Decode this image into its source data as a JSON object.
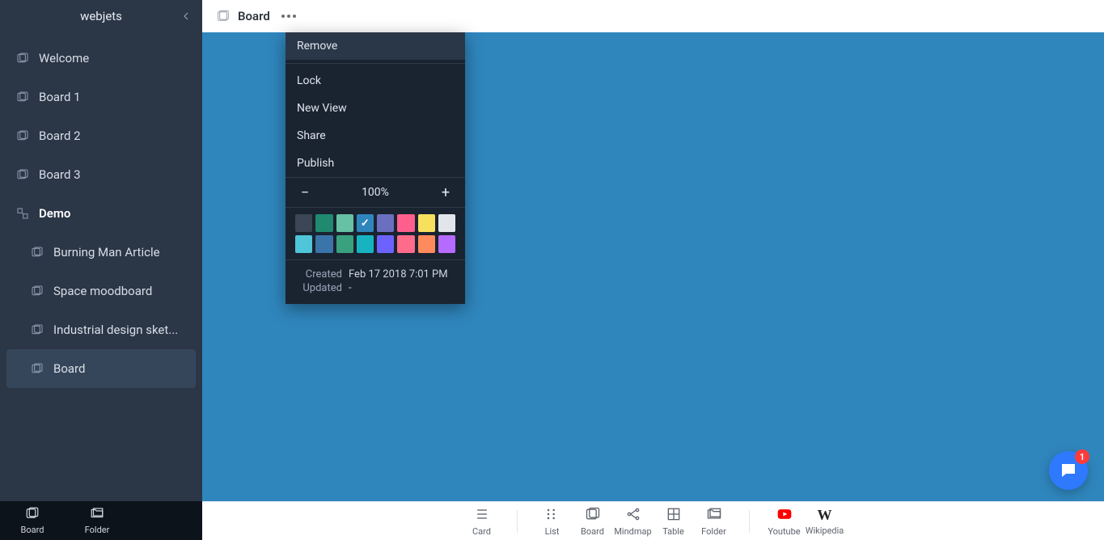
{
  "app": {
    "title": "webjets"
  },
  "sidebar": {
    "items": [
      {
        "label": "Welcome",
        "child": false,
        "bold": false,
        "active": false,
        "icon": "board"
      },
      {
        "label": "Board 1",
        "child": false,
        "bold": false,
        "active": false,
        "icon": "board"
      },
      {
        "label": "Board 2",
        "child": false,
        "bold": false,
        "active": false,
        "icon": "board"
      },
      {
        "label": "Board 3",
        "child": false,
        "bold": false,
        "active": false,
        "icon": "board"
      },
      {
        "label": "Demo",
        "child": false,
        "bold": true,
        "active": false,
        "icon": "expand"
      },
      {
        "label": "Burning Man Article",
        "child": true,
        "bold": false,
        "active": false,
        "icon": "board"
      },
      {
        "label": "Space moodboard",
        "child": true,
        "bold": false,
        "active": false,
        "icon": "board"
      },
      {
        "label": "Industrial design sket...",
        "child": true,
        "bold": false,
        "active": false,
        "icon": "board"
      },
      {
        "label": "Board",
        "child": true,
        "bold": false,
        "active": true,
        "icon": "board"
      }
    ],
    "footer": [
      {
        "label": "Board",
        "icon": "board"
      },
      {
        "label": "Folder",
        "icon": "folder"
      }
    ]
  },
  "header": {
    "title": "Board",
    "actions": [
      "star",
      "inbox",
      "trash",
      "user"
    ]
  },
  "menu": {
    "items": [
      "Remove",
      "Lock",
      "New View",
      "Share",
      "Publish"
    ],
    "highlight_index": 0,
    "zoom": "100%",
    "palette_row1": [
      "#3b4656",
      "#1f8a70",
      "#66c1a5",
      "#2f86bd",
      "#6b6fbf",
      "#ff5f8d",
      "#f6e05e",
      "#e2e6ea"
    ],
    "palette_row2": [
      "#4fc5d9",
      "#3a74a8",
      "#3aa17e",
      "#17b3c1",
      "#6c63ff",
      "#ff6b8a",
      "#ff8a5b",
      "#b56bff"
    ],
    "selected_color_index": 3,
    "created_label": "Created",
    "created_value": "Feb 17 2018 7:01 PM",
    "updated_label": "Updated",
    "updated_value": "-"
  },
  "toolbar": {
    "groups": [
      [
        {
          "label": "Card",
          "icon": "card"
        }
      ],
      [
        {
          "label": "List",
          "icon": "list"
        },
        {
          "label": "Board",
          "icon": "board"
        },
        {
          "label": "Mindmap",
          "icon": "mindmap"
        },
        {
          "label": "Table",
          "icon": "table"
        },
        {
          "label": "Folder",
          "icon": "folder"
        }
      ],
      [
        {
          "label": "Youtube",
          "icon": "youtube"
        },
        {
          "label": "Wikipedia",
          "icon": "wikipedia"
        }
      ]
    ]
  },
  "chat": {
    "badge": "1"
  },
  "colors": {
    "canvas": "#2f86bd"
  }
}
